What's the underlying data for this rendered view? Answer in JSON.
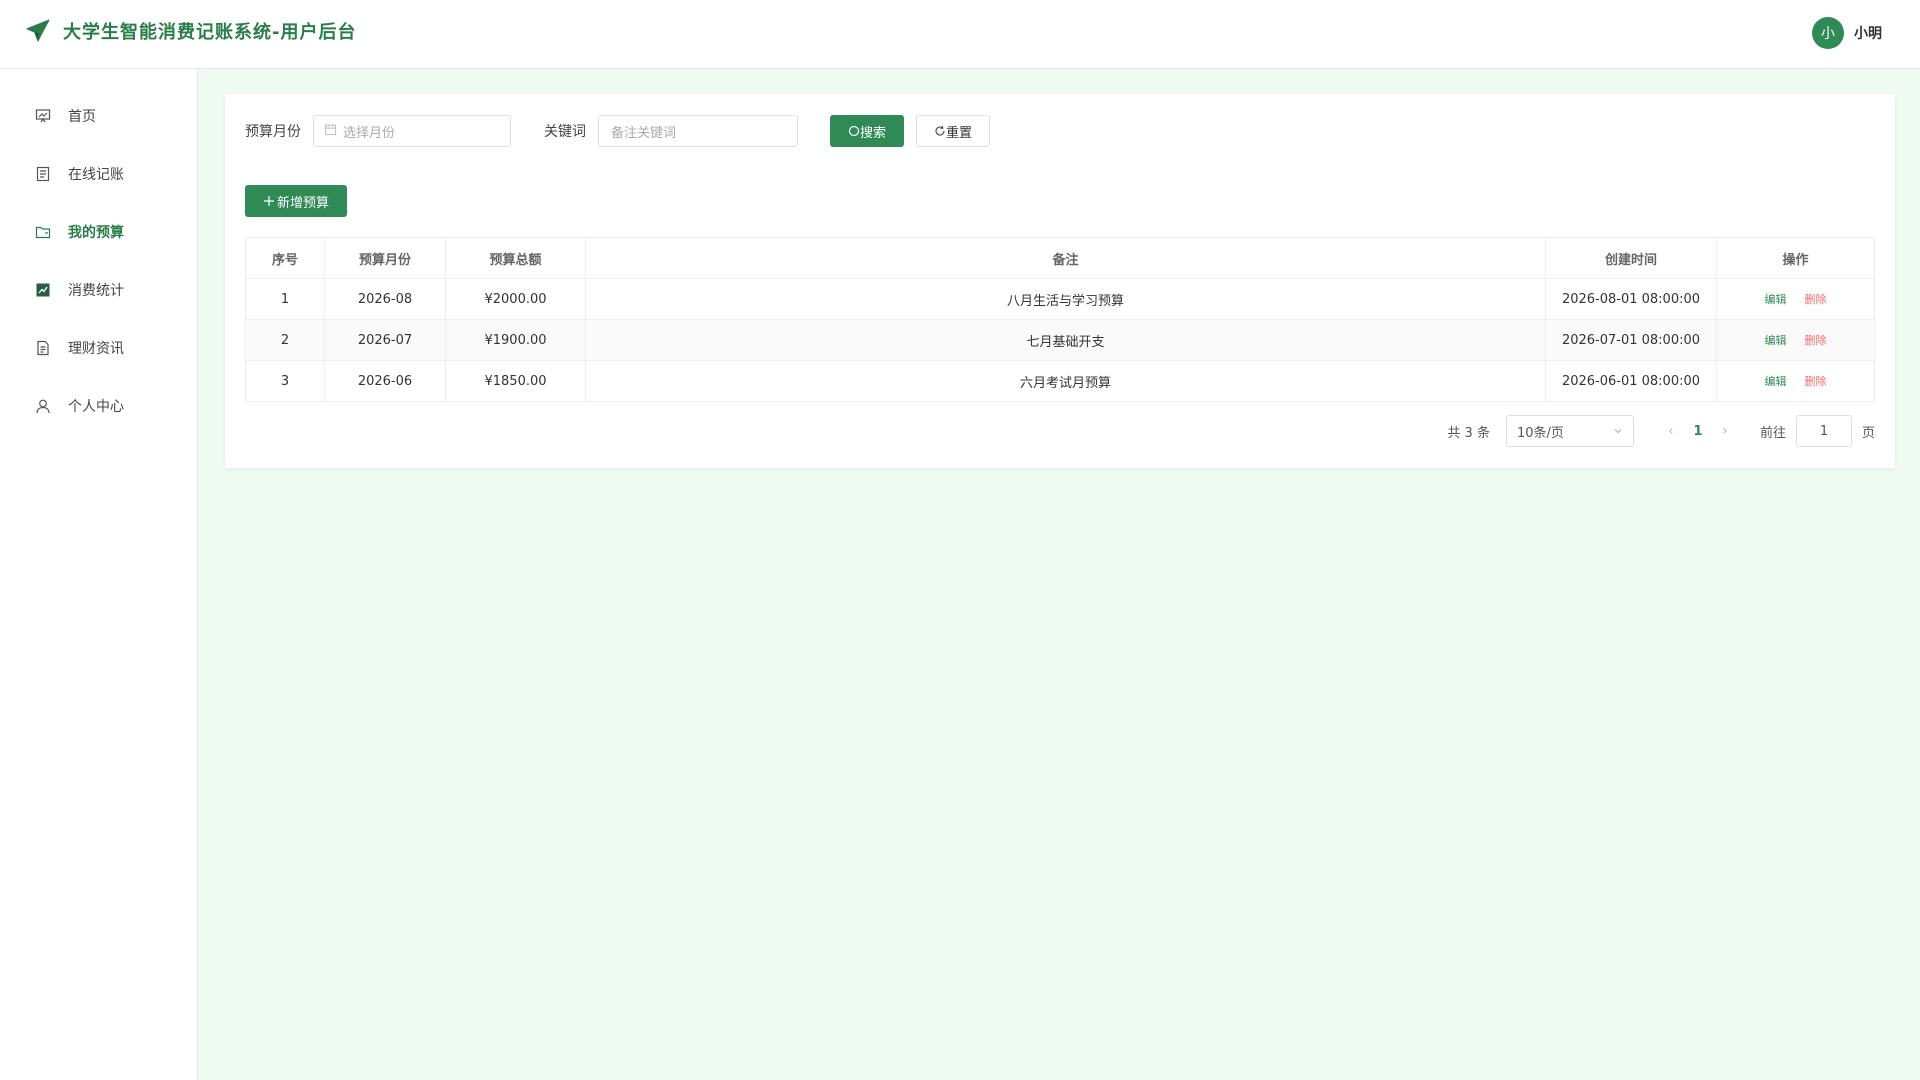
{
  "header": {
    "title": "大学生智能消费记账系统-用户后台",
    "avatar_text": "小",
    "username": "小明"
  },
  "sidebar": {
    "items": [
      {
        "label": "首页",
        "icon": "dashboard-icon",
        "active": false
      },
      {
        "label": "在线记账",
        "icon": "document-icon",
        "active": false
      },
      {
        "label": "我的预算",
        "icon": "folder-icon",
        "active": true
      },
      {
        "label": "消费统计",
        "icon": "chart-icon",
        "active": false
      },
      {
        "label": "理财资讯",
        "icon": "news-icon",
        "active": false
      },
      {
        "label": "个人中心",
        "icon": "user-icon",
        "active": false
      }
    ]
  },
  "filters": {
    "month_label": "预算月份",
    "month_placeholder": "选择月份",
    "keyword_label": "关键词",
    "keyword_placeholder": "备注关键词",
    "search_label": "搜索",
    "reset_label": "重置"
  },
  "add_label": "新增预算",
  "table": {
    "headers": [
      "序号",
      "预算月份",
      "预算总额",
      "备注",
      "创建时间",
      "操作"
    ],
    "rows": [
      [
        "1",
        "2026-08",
        "¥2000.00",
        "八月生活与学习预算",
        "2026-08-01 08:00:00"
      ],
      [
        "2",
        "2026-07",
        "¥1900.00",
        "七月基础开支",
        "2026-07-01 08:00:00"
      ],
      [
        "3",
        "2026-06",
        "¥1850.00",
        "六月考试月预算",
        "2026-06-01 08:00:00"
      ]
    ],
    "edit_label": "编辑",
    "delete_label": "删除"
  },
  "pager": {
    "total_text": "共 3 条",
    "page_size": "10条/页",
    "current_page": "1",
    "goto_label": "前往",
    "goto_value": "1",
    "page_suffix": "页"
  },
  "colors": {
    "accent": "#2f8a55",
    "danger": "#f56c6c",
    "background": "#f0fbf4"
  }
}
